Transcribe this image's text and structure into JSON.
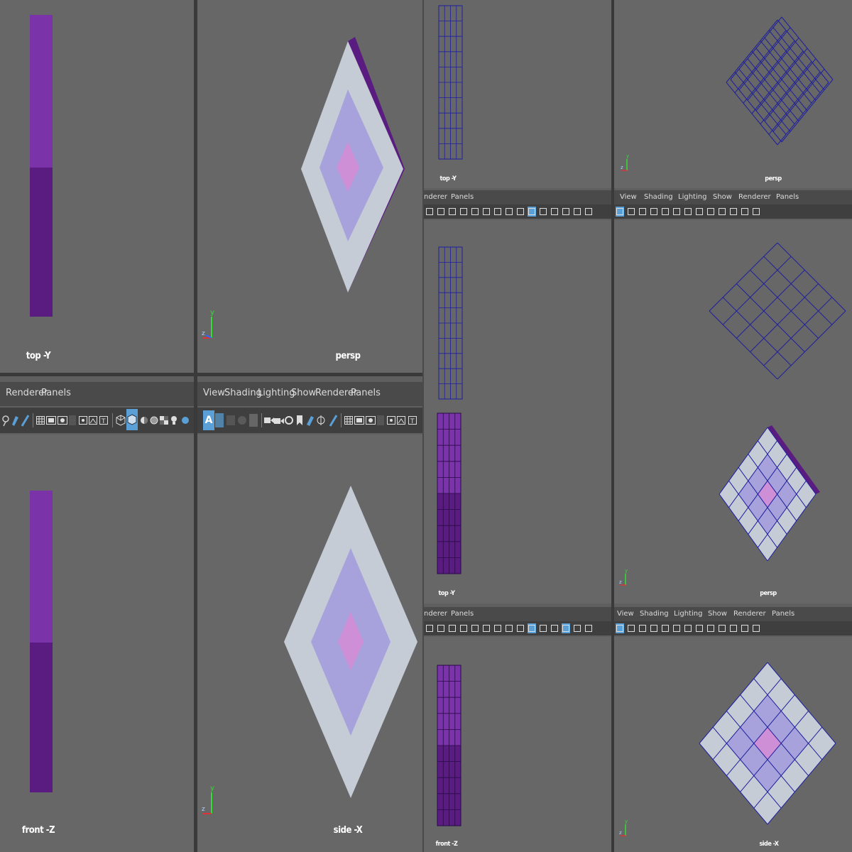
{
  "colors": {
    "viewport_bg": "#676767",
    "menubar_bg": "#4a4a4a",
    "toolbar_bg": "#3f3f3f",
    "purple_light": "#7a33a8",
    "purple_dark": "#5a1c80",
    "wire_blue": "#1e1f9c",
    "plane_outer": "#c6ccd6",
    "plane_mid": "#a7a2dc",
    "plane_inner": "#cf8fd6",
    "active_icon": "#5aa0d6"
  },
  "left": {
    "top_label": "top -Y",
    "persp_label": "persp",
    "front_label": "front -Z",
    "side_label": "side -X",
    "menu_left": [
      "Renderer",
      "Panels"
    ],
    "menu_right": [
      "View",
      "Shading",
      "Lighting",
      "Show",
      "Renderer",
      "Panels"
    ]
  },
  "right": {
    "top1_label": "top -Y",
    "persp1_label": "persp",
    "top2_label": "top -Y",
    "persp2_label": "persp",
    "front_label": "front -Z",
    "side_label": "side -X",
    "menu_left": [
      "nderer",
      "Panels"
    ],
    "menu_right": [
      "View",
      "Shading",
      "Lighting",
      "Show",
      "Renderer",
      "Panels"
    ]
  },
  "axis": {
    "x": "x",
    "y": "y",
    "z": "z"
  },
  "icons": {
    "toolbar_left": [
      "lasso-icon",
      "pencil-icon",
      "grid-icon",
      "film-gate-icon",
      "resolution-gate-icon",
      "safe-action-icon",
      "field-chart-icon",
      "camera-attrs-icon",
      "wireframe-cube-icon",
      "shaded-cube-icon",
      "textured-icon",
      "default-light-icon",
      "checker-icon",
      "bulb-icon",
      "shadow-icon"
    ],
    "toolbar_right": [
      "a-icon",
      "shaded-button-icon",
      "texture-sphere-icon",
      "xray-icon",
      "camera-icon",
      "bookmark-icon",
      "two-d-pan-icon",
      "pencil-icon",
      "grid-icon",
      "film-gate-icon",
      "resolution-gate-icon",
      "safe-action-icon",
      "field-chart-icon"
    ]
  }
}
